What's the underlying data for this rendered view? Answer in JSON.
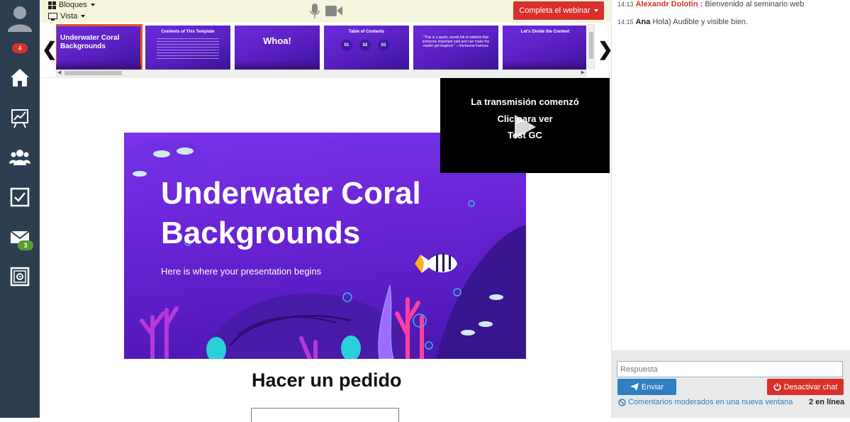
{
  "sidebar": {
    "notifications_badge": "4",
    "mail_badge": "3"
  },
  "topbar": {
    "bloques_label": "Bloques",
    "vista_label": "Vista",
    "webinar_button": "Completa el webinar"
  },
  "thumbnails": [
    {
      "title": "Underwater Coral Backgrounds"
    },
    {
      "title": "Contents of This Template"
    },
    {
      "title": "Whoa!"
    },
    {
      "title": "Table of Contents",
      "numbers": [
        "01",
        "02",
        "03"
      ]
    },
    {
      "title": "\"This is a quote, words full of wisdom that someone important said and can make the reader get inspired.\" —Someone Famous"
    },
    {
      "title": "Let's Divide the Content"
    }
  ],
  "slide": {
    "title": "Underwater Coral Backgrounds",
    "subtitle": "Here is where your presentation begins"
  },
  "stream": {
    "line1": "La transmisión comenzó",
    "line2": "Clic para ver",
    "line3": "Test GC"
  },
  "order": {
    "heading": "Hacer un pedido"
  },
  "chat": {
    "messages": [
      {
        "time": "14:13",
        "user": "Alexandr Dolotin :",
        "text": "Bienvenido al seminario web",
        "user_color": "#d9302b"
      },
      {
        "time": "14:15",
        "user": "Ana",
        "text": "Hola) Audible y visible bien.",
        "user_color": "#222222"
      }
    ],
    "input_placeholder": "Respuesta",
    "send_label": "Enviar",
    "deactivate_label": "Desactivar chat",
    "moderated_link": "Comentarios moderados en una nueva ventana",
    "online_count": "2 en línea"
  },
  "colors": {
    "sidebar_bg": "#2c3e50",
    "accent_red": "#d9302b",
    "accent_blue": "#2f7fc1",
    "slide_purple": "#6a24d6"
  }
}
